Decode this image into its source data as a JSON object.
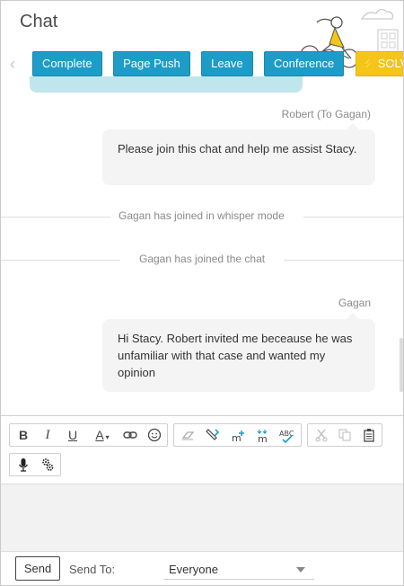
{
  "header": {
    "title": "Chat",
    "buttons": {
      "complete": "Complete",
      "page_push": "Page Push",
      "leave": "Leave",
      "conference": "Conference",
      "solve": "SOLVE"
    }
  },
  "messages": {
    "msg1_sender": "Robert (To Gagan)",
    "msg1_text": "Please join this chat and help me assist Stacy.",
    "sys1": "Gagan has joined in whisper mode",
    "sys2": "Gagan has joined the chat",
    "msg2_sender": "Gagan",
    "msg2_text": "Hi Stacy. Robert invited me beceause he was unfamiliar with that case and wanted my opinion"
  },
  "editor": {
    "bold": "B",
    "italic": "I",
    "underline": "U",
    "font_color": "A"
  },
  "footer": {
    "send_label": "Send",
    "send_to_label": "Send To:",
    "recipient_value": "Everyone"
  },
  "colors": {
    "action_button": "#1e9cc8",
    "solve_button": "#f5c518",
    "bubble": "#f4f4f4"
  }
}
